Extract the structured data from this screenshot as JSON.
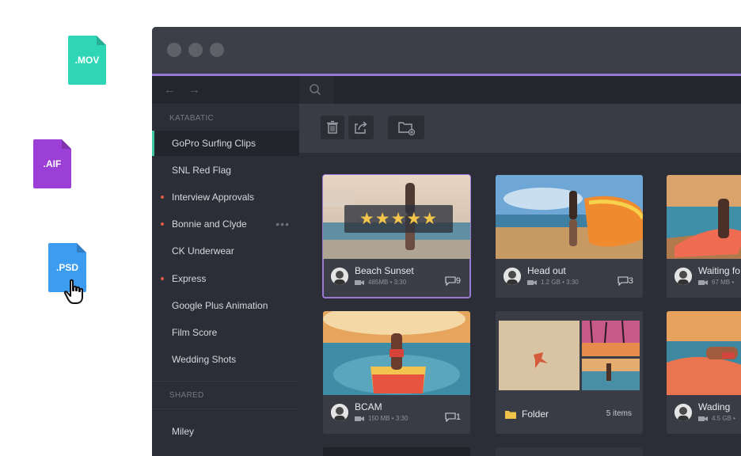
{
  "floating_files": [
    {
      "ext": ".MOV",
      "color": "#2fd6b5"
    },
    {
      "ext": ".AIF",
      "color": "#9b3fd6"
    },
    {
      "ext": ".PSD",
      "color": "#3b9cf0"
    }
  ],
  "sidebar": {
    "section1_label": "KATABATIC",
    "items": [
      {
        "label": "GoPro Surfing Clips",
        "active": true
      },
      {
        "label": "SNL Red Flag"
      },
      {
        "label": "Interview Approvals",
        "dot": true
      },
      {
        "label": "Bonnie and Clyde",
        "dot": true,
        "more": "•••"
      },
      {
        "label": "CK Underwear"
      },
      {
        "label": "Express",
        "dot": true
      },
      {
        "label": "Google Plus Animation"
      },
      {
        "label": "Film Score"
      },
      {
        "label": "Wedding Shots"
      }
    ],
    "section2_label": "SHARED",
    "shared_items": [
      {
        "label": "Miley"
      }
    ]
  },
  "cards": [
    {
      "title": "Beach Sunset",
      "meta": "485MB • 3:30",
      "comments": "9",
      "rating": "★★★★★",
      "selected": true
    },
    {
      "title": "Head out",
      "meta": "1.2 GB • 3:30",
      "comments": "3"
    },
    {
      "title": "Waiting fo",
      "meta": "67 MB •",
      "comments": ""
    },
    {
      "title": "BCAM",
      "meta": "150 MB • 3:30",
      "comments": "1"
    },
    {
      "folder": true,
      "title": "Folder",
      "count": "5 items"
    },
    {
      "title": "Wading",
      "meta": "4.5 GB •",
      "comments": ""
    }
  ],
  "colors": {
    "accent_purple": "#9a7ad6",
    "active_accent": "#3fc7a0",
    "status_dot": "#e05a45",
    "star": "#f3c54a"
  }
}
